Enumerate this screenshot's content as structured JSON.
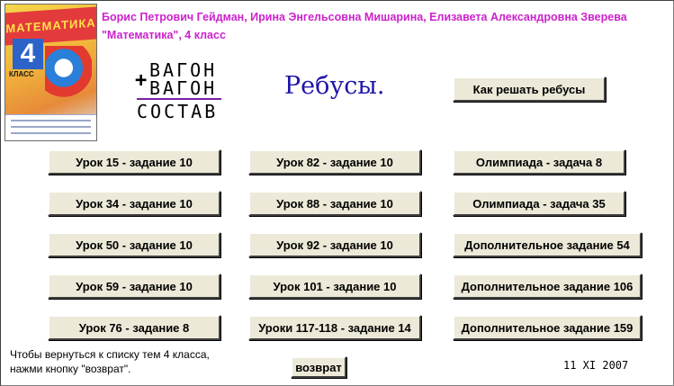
{
  "header": {
    "authors": "Борис Петрович Гейдман, Ирина Энгельсовна Мишарина, Елизавета Александровна Зверева",
    "book": "\"Математика\", 4 класс"
  },
  "cover": {
    "title": "МАТЕМАТИКА",
    "grade": "4",
    "grade_label": "КЛАСС"
  },
  "rebus": {
    "plus": "+",
    "line1": "ВАГОН",
    "line2": "ВАГОН",
    "result": "СОСТАВ"
  },
  "page_title": "Ребусы.",
  "how_button": "Как решать ребусы",
  "columns": [
    [
      "Урок 15 - задание 10",
      "Урок 34 - задание 10",
      "Урок 50 - задание 10",
      "Урок 59 - задание 10",
      "Урок 76 - задание 8"
    ],
    [
      "Урок 82 - задание 10",
      "Урок 88 - задание 10",
      "Урок 92 - задание 10",
      "Урок 101 - задание 10",
      "Уроки 117-118 - задание 14"
    ],
    [
      "Олимпиада - задача 8",
      "Олимпиада - задача 35",
      "Дополнительное задание 54",
      "Дополнительное задание 106",
      "Дополнительное задание 159"
    ]
  ],
  "footer": {
    "note_line1": "Чтобы вернуться к списку тем 4 класса,",
    "note_line2": "нажми кнопку \"возврат\".",
    "back_button": "возврат",
    "date": "11 XI 2007"
  }
}
